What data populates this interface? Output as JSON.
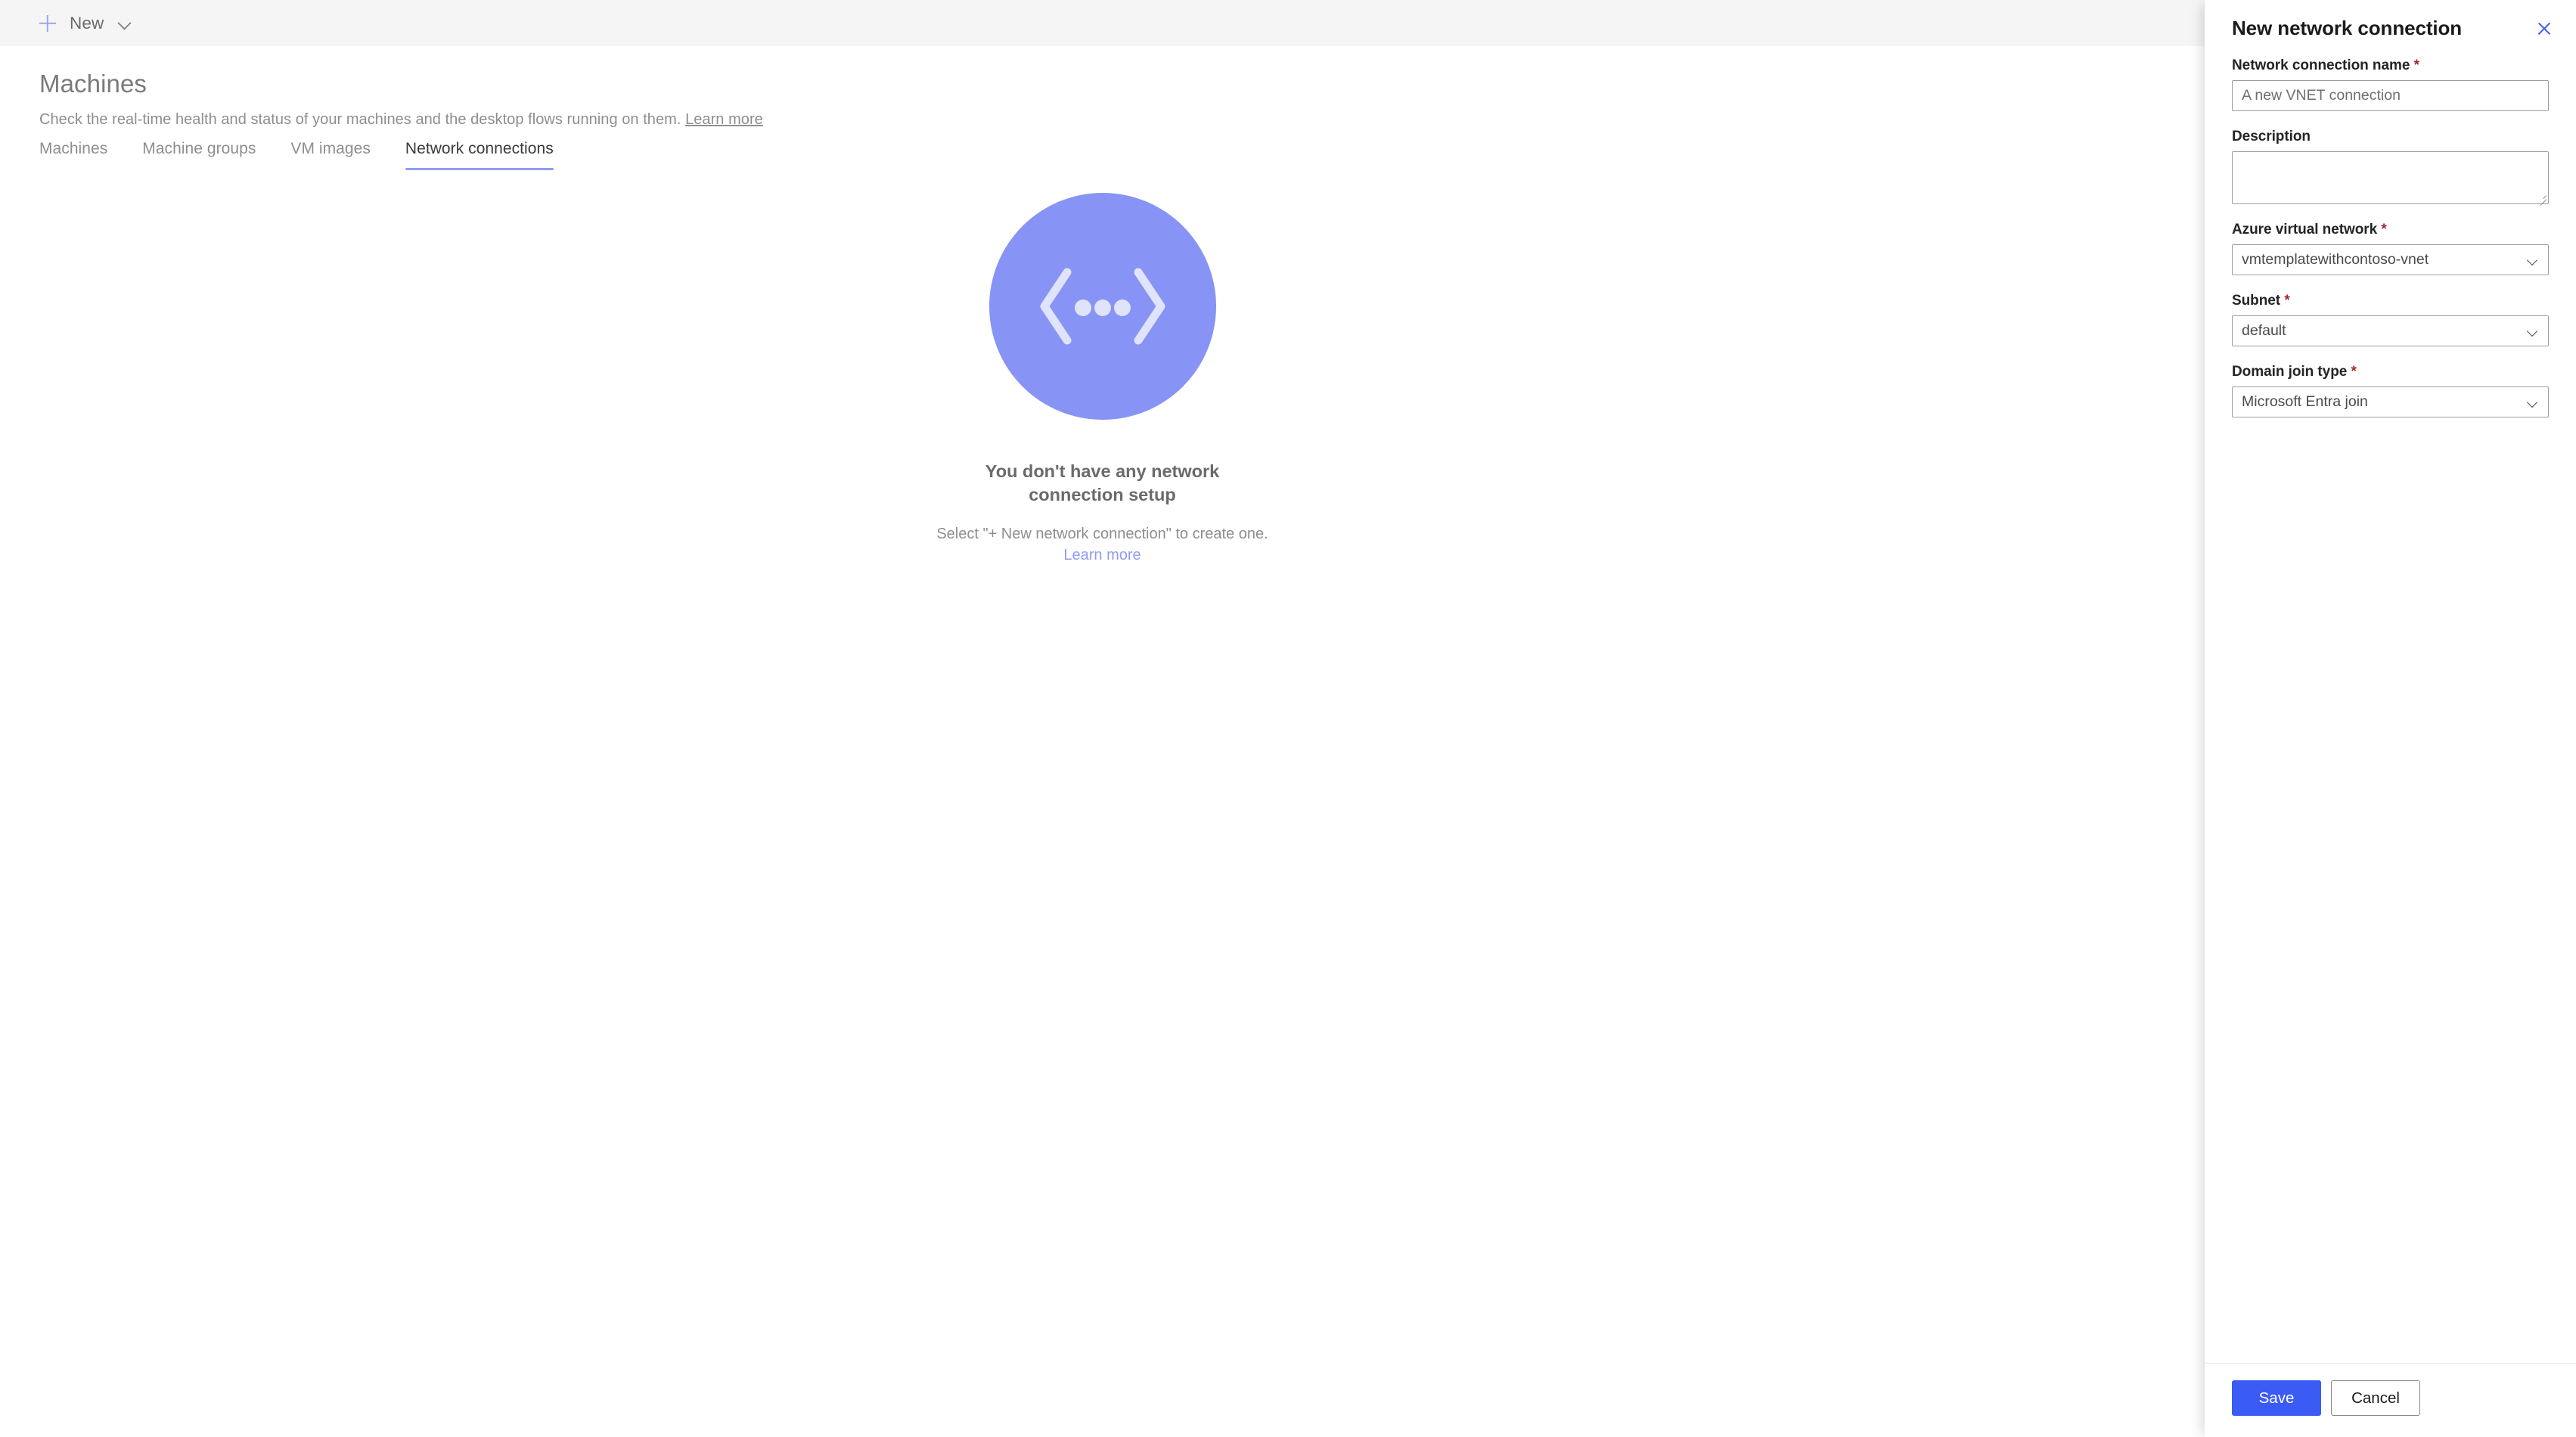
{
  "commandbar": {
    "new_label": "New"
  },
  "page": {
    "title": "Machines",
    "subtitle": "Check the real-time health and status of your machines and the desktop flows running on them.",
    "subtitle_link": "Learn more"
  },
  "tabs": [
    {
      "label": "Machines",
      "active": false
    },
    {
      "label": "Machine groups",
      "active": false
    },
    {
      "label": "VM images",
      "active": false
    },
    {
      "label": "Network connections",
      "active": true
    }
  ],
  "empty_state": {
    "title": "You don't have any network connection setup",
    "subtitle": "Select \"+ New network connection\" to create one.",
    "subtitle_link": "Learn more",
    "illustration_color": "#8794f5"
  },
  "panel": {
    "title": "New network connection",
    "fields": {
      "name": {
        "label": "Network connection name",
        "required": true,
        "value": "",
        "placeholder": "A new VNET connection"
      },
      "description": {
        "label": "Description",
        "required": false,
        "value": "",
        "placeholder": ""
      },
      "vnet": {
        "label": "Azure virtual network",
        "required": true,
        "value": "vmtemplatewithcontoso-vnet"
      },
      "subnet": {
        "label": "Subnet",
        "required": true,
        "value": "default"
      },
      "domain_join": {
        "label": "Domain join type",
        "required": true,
        "value": "Microsoft Entra join"
      }
    },
    "footer": {
      "save_label": "Save",
      "cancel_label": "Cancel"
    }
  },
  "colors": {
    "accent_blue": "#3b5bf5",
    "periwinkle": "#8f9cf2",
    "required_red": "#a4262c"
  }
}
